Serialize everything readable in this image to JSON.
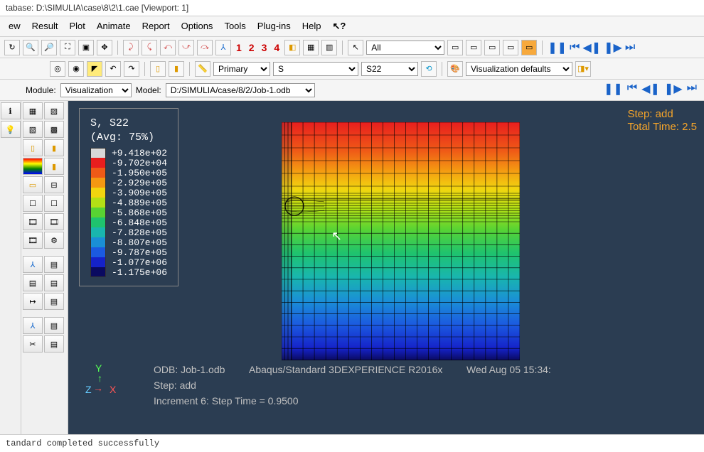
{
  "title": "tabase: D:\\SIMULIA\\case\\8\\2\\1.cae  [Viewport: 1]",
  "menu": [
    "ew",
    "Result",
    "Plot",
    "Animate",
    "Report",
    "Options",
    "Tools",
    "Plug-ins",
    "Help"
  ],
  "toolbar1": {
    "display_group": "All",
    "numbers": [
      "1",
      "2",
      "3",
      "4"
    ]
  },
  "toolbar2": {
    "mode": "Primary",
    "var": "S",
    "comp": "S22",
    "vizdef": "Visualization defaults"
  },
  "context": {
    "module_label": "Module:",
    "module": "Visualization",
    "model_label": "Model:",
    "model": "D:/SIMULIA/case/8/2/Job-1.odb"
  },
  "legend": {
    "title": "S, S22",
    "avg": "(Avg: 75%)",
    "entries": [
      {
        "c": "#d8d8d8",
        "v": "+9.418e+02"
      },
      {
        "c": "#e81e1e",
        "v": "-9.702e+04"
      },
      {
        "c": "#ef5a17",
        "v": "-1.950e+05"
      },
      {
        "c": "#f49812",
        "v": "-2.929e+05"
      },
      {
        "c": "#f2d50f",
        "v": "-3.909e+05"
      },
      {
        "c": "#b3e015",
        "v": "-4.889e+05"
      },
      {
        "c": "#58d333",
        "v": "-5.868e+05"
      },
      {
        "c": "#1fc36e",
        "v": "-6.848e+05"
      },
      {
        "c": "#19b6ae",
        "v": "-7.828e+05"
      },
      {
        "c": "#1a8fd6",
        "v": "-8.807e+05"
      },
      {
        "c": "#1b5ae0",
        "v": "-9.787e+05"
      },
      {
        "c": "#1522c9",
        "v": "-1.077e+06"
      },
      {
        "c": "#0a0a60",
        "v": "-1.175e+06"
      }
    ]
  },
  "step_overlay": {
    "l1": "Step: add",
    "l2": "Total Time: 2.5"
  },
  "info": {
    "odb": "ODB: Job-1.odb",
    "product": "Abaqus/Standard 3DEXPERIENCE R2016x",
    "date": "Wed Aug 05 15:34:",
    "step": "Step: add",
    "incr": "Increment     6: Step Time =   0.9500"
  },
  "status": "tandard completed successfully",
  "chart_data": {
    "type": "heatmap",
    "title": "S, S22 (Avg 75%)",
    "field": "S22",
    "range": [
      -1175000.0,
      941.8
    ],
    "colormap": [
      "#0a0a60",
      "#1522c9",
      "#1b5ae0",
      "#1a8fd6",
      "#19b6ae",
      "#1fc36e",
      "#58d333",
      "#b3e015",
      "#f2d50f",
      "#f49812",
      "#ef5a17",
      "#e81e1e"
    ],
    "grid": {
      "nx": 20,
      "ny": 22
    },
    "note": "Rectangular FE mesh with stress ranging roughly linearly from max (top) to min (bottom); small circular inclusion/hole near left edge at ~25% depth causing local mesh refinement."
  }
}
